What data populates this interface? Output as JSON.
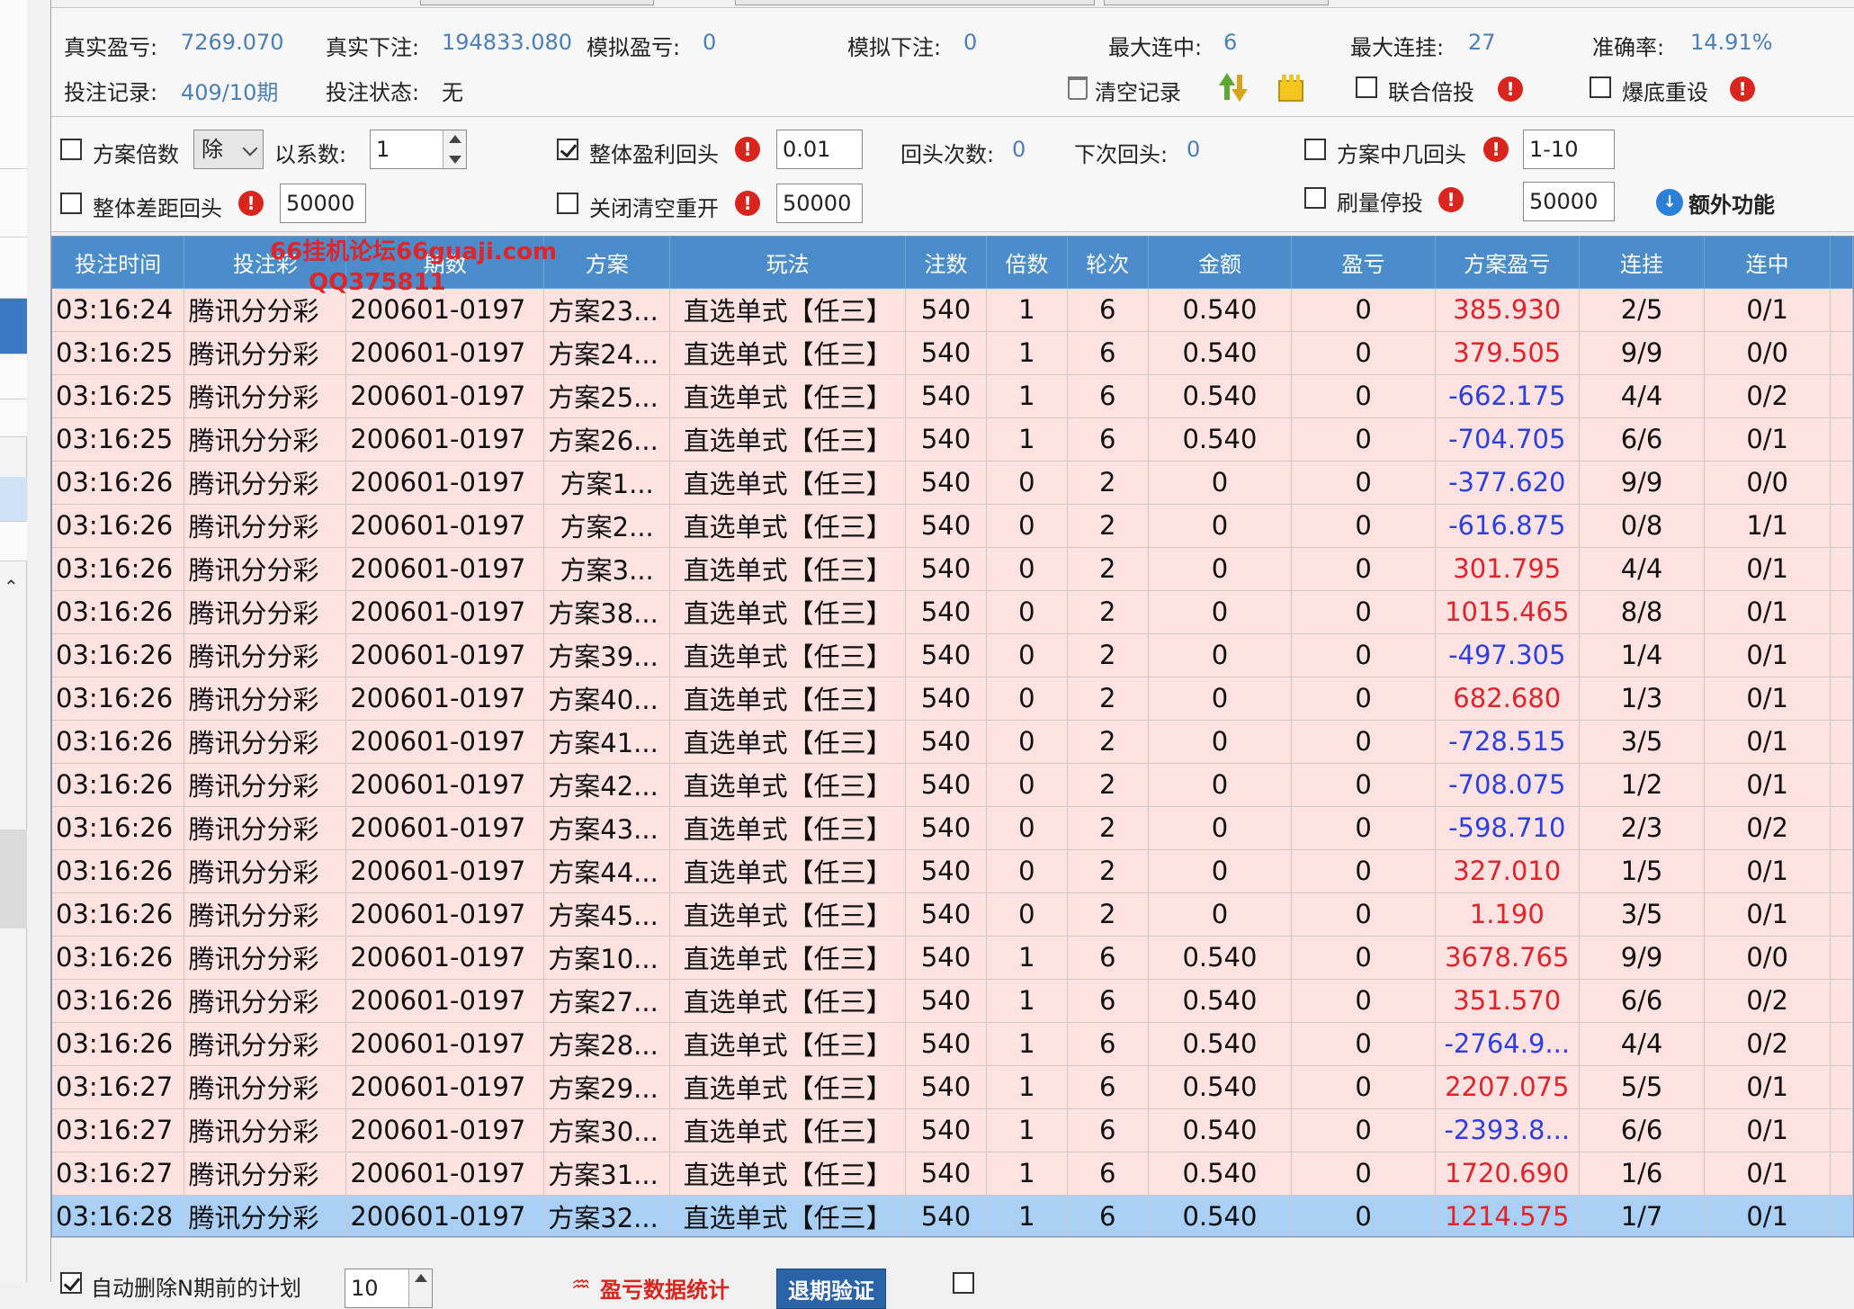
{
  "stats": {
    "real_profit_label": "真实盈亏:",
    "real_profit": "7269.070",
    "real_bet_label": "真实下注:",
    "real_bet": "194833.080",
    "sim_profit_label": "模拟盈亏:",
    "sim_profit": "0",
    "sim_bet_label": "模拟下注:",
    "sim_bet": "0",
    "max_win_label": "最大连中:",
    "max_win": "6",
    "max_lose_label": "最大连挂:",
    "max_lose": "27",
    "accuracy_label": "准确率:",
    "accuracy": "14.91%",
    "record_label": "投注记录:",
    "record": "409/10期",
    "status_label": "投注状态:",
    "status": "无",
    "clear_label": "清空记录",
    "joint_multiple_label": "联合倍投",
    "bust_reset_label": "爆底重设"
  },
  "controls": {
    "plan_multiple_label": "方案倍数",
    "divide_select": "除",
    "coef_label": "以系数:",
    "coef_value": "1",
    "overall_profit_return_label": "整体盈利回头",
    "overall_profit_return_value": "0.01",
    "return_count_label": "回头次数:",
    "return_count": "0",
    "next_return_label": "下次回头:",
    "next_return": "0",
    "plan_win_return_label": "方案中几回头",
    "plan_win_return_value": "1-10",
    "overall_gap_return_label": "整体差距回头",
    "overall_gap_return_value": "50000",
    "close_clear_restart_label": "关闭清空重开",
    "close_clear_restart_value": "50000",
    "volume_stop_label": "刷量停投",
    "volume_stop_value": "50000",
    "extra_label": "额外功能"
  },
  "watermark": {
    "line1": "66挂机论坛66guaji.com",
    "line2": "QQ375811"
  },
  "table": {
    "headers": [
      "投注时间",
      "投注彩",
      "期数",
      "方案",
      "玩法",
      "注数",
      "倍数",
      "轮次",
      "金额",
      "盈亏",
      "方案盈亏",
      "连挂",
      "连中"
    ],
    "rows": [
      [
        "03:16:24",
        "腾讯分分彩",
        "200601-0197",
        "方案23...",
        "直选单式【任三】",
        "540",
        "1",
        "6",
        "0.540",
        "0",
        "385.930",
        "2/5",
        "0/1"
      ],
      [
        "03:16:25",
        "腾讯分分彩",
        "200601-0197",
        "方案24...",
        "直选单式【任三】",
        "540",
        "1",
        "6",
        "0.540",
        "0",
        "379.505",
        "9/9",
        "0/0"
      ],
      [
        "03:16:25",
        "腾讯分分彩",
        "200601-0197",
        "方案25...",
        "直选单式【任三】",
        "540",
        "1",
        "6",
        "0.540",
        "0",
        "-662.175",
        "4/4",
        "0/2"
      ],
      [
        "03:16:25",
        "腾讯分分彩",
        "200601-0197",
        "方案26...",
        "直选单式【任三】",
        "540",
        "1",
        "6",
        "0.540",
        "0",
        "-704.705",
        "6/6",
        "0/1"
      ],
      [
        "03:16:26",
        "腾讯分分彩",
        "200601-0197",
        "方案1...",
        "直选单式【任三】",
        "540",
        "0",
        "2",
        "0",
        "0",
        "-377.620",
        "9/9",
        "0/0"
      ],
      [
        "03:16:26",
        "腾讯分分彩",
        "200601-0197",
        "方案2...",
        "直选单式【任三】",
        "540",
        "0",
        "2",
        "0",
        "0",
        "-616.875",
        "0/8",
        "1/1"
      ],
      [
        "03:16:26",
        "腾讯分分彩",
        "200601-0197",
        "方案3...",
        "直选单式【任三】",
        "540",
        "0",
        "2",
        "0",
        "0",
        "301.795",
        "4/4",
        "0/1"
      ],
      [
        "03:16:26",
        "腾讯分分彩",
        "200601-0197",
        "方案38...",
        "直选单式【任三】",
        "540",
        "0",
        "2",
        "0",
        "0",
        "1015.465",
        "8/8",
        "0/1"
      ],
      [
        "03:16:26",
        "腾讯分分彩",
        "200601-0197",
        "方案39...",
        "直选单式【任三】",
        "540",
        "0",
        "2",
        "0",
        "0",
        "-497.305",
        "1/4",
        "0/1"
      ],
      [
        "03:16:26",
        "腾讯分分彩",
        "200601-0197",
        "方案40...",
        "直选单式【任三】",
        "540",
        "0",
        "2",
        "0",
        "0",
        "682.680",
        "1/3",
        "0/1"
      ],
      [
        "03:16:26",
        "腾讯分分彩",
        "200601-0197",
        "方案41...",
        "直选单式【任三】",
        "540",
        "0",
        "2",
        "0",
        "0",
        "-728.515",
        "3/5",
        "0/1"
      ],
      [
        "03:16:26",
        "腾讯分分彩",
        "200601-0197",
        "方案42...",
        "直选单式【任三】",
        "540",
        "0",
        "2",
        "0",
        "0",
        "-708.075",
        "1/2",
        "0/1"
      ],
      [
        "03:16:26",
        "腾讯分分彩",
        "200601-0197",
        "方案43...",
        "直选单式【任三】",
        "540",
        "0",
        "2",
        "0",
        "0",
        "-598.710",
        "2/3",
        "0/2"
      ],
      [
        "03:16:26",
        "腾讯分分彩",
        "200601-0197",
        "方案44...",
        "直选单式【任三】",
        "540",
        "0",
        "2",
        "0",
        "0",
        "327.010",
        "1/5",
        "0/1"
      ],
      [
        "03:16:26",
        "腾讯分分彩",
        "200601-0197",
        "方案45...",
        "直选单式【任三】",
        "540",
        "0",
        "2",
        "0",
        "0",
        "1.190",
        "3/5",
        "0/1"
      ],
      [
        "03:16:26",
        "腾讯分分彩",
        "200601-0197",
        "方案10...",
        "直选单式【任三】",
        "540",
        "1",
        "6",
        "0.540",
        "0",
        "3678.765",
        "9/9",
        "0/0"
      ],
      [
        "03:16:26",
        "腾讯分分彩",
        "200601-0197",
        "方案27...",
        "直选单式【任三】",
        "540",
        "1",
        "6",
        "0.540",
        "0",
        "351.570",
        "6/6",
        "0/2"
      ],
      [
        "03:16:26",
        "腾讯分分彩",
        "200601-0197",
        "方案28...",
        "直选单式【任三】",
        "540",
        "1",
        "6",
        "0.540",
        "0",
        "-2764.9...",
        "4/4",
        "0/2"
      ],
      [
        "03:16:27",
        "腾讯分分彩",
        "200601-0197",
        "方案29...",
        "直选单式【任三】",
        "540",
        "1",
        "6",
        "0.540",
        "0",
        "2207.075",
        "5/5",
        "0/1"
      ],
      [
        "03:16:27",
        "腾讯分分彩",
        "200601-0197",
        "方案30...",
        "直选单式【任三】",
        "540",
        "1",
        "6",
        "0.540",
        "0",
        "-2393.8...",
        "6/6",
        "0/1"
      ],
      [
        "03:16:27",
        "腾讯分分彩",
        "200601-0197",
        "方案31...",
        "直选单式【任三】",
        "540",
        "1",
        "6",
        "0.540",
        "0",
        "1720.690",
        "1/6",
        "0/1"
      ],
      [
        "03:16:28",
        "腾讯分分彩",
        "200601-0197",
        "方案32...",
        "直选单式【任三】",
        "540",
        "1",
        "6",
        "0.540",
        "0",
        "1214.575",
        "1/7",
        "0/1"
      ]
    ],
    "selected_row": 21
  },
  "bottom": {
    "auto_delete_label": "自动删除N期前的计划",
    "auto_delete_value": "10",
    "stats_label": "盈亏数据统计",
    "verify_button": "退期验证"
  }
}
